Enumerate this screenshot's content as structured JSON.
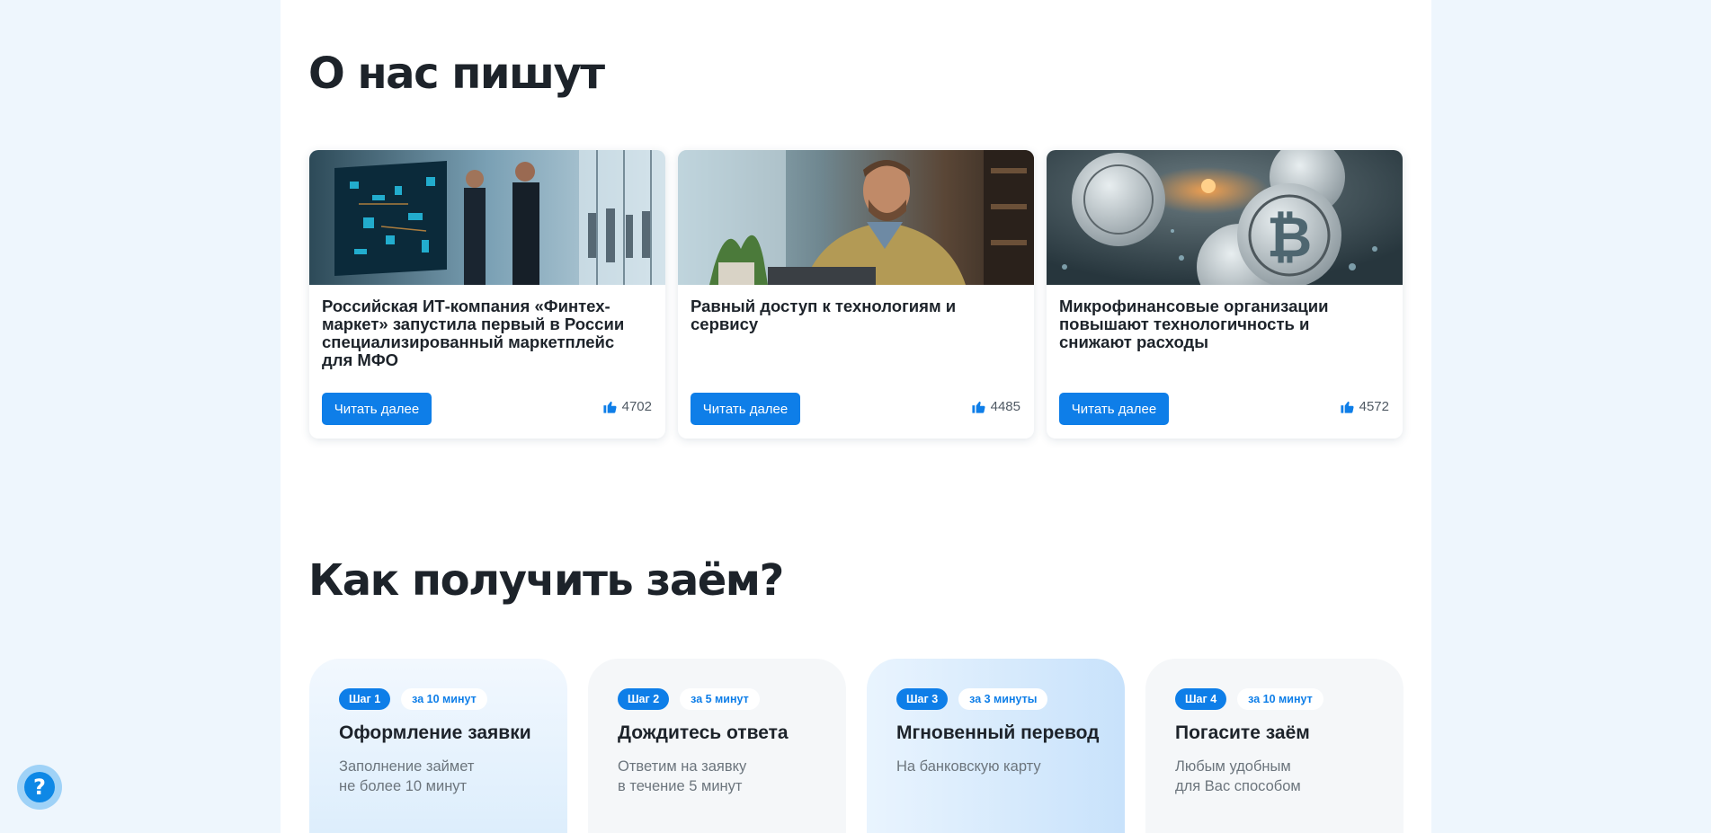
{
  "press": {
    "title": "О нас пишут",
    "read_more_label": "Читать далее",
    "articles": [
      {
        "title": "Российская ИТ-компания «Финтех-маркет» запустила первый в России специализированный маркетплейс для МФО",
        "likes": "4702",
        "image": "business-people-at-digital-screen-photo"
      },
      {
        "title": "Равный доступ к технологиям и сервису",
        "likes": "4485",
        "image": "man-at-laptop-photo"
      },
      {
        "title": "Микрофинансовые организации повышают технологичность и снижают расходы",
        "likes": "4572",
        "image": "bitcoin-coins-photo"
      }
    ]
  },
  "how": {
    "title": "Как получить заём?",
    "steps": [
      {
        "badge": "Шаг 1",
        "time": "за 10 минут",
        "title": "Оформление заявки",
        "text": "Заполнение займет\nне более 10 минут"
      },
      {
        "badge": "Шаг 2",
        "time": "за 5 минут",
        "title": "Дождитесь ответа",
        "text": "Ответим на заявку\nв течение 5 минут"
      },
      {
        "badge": "Шаг 3",
        "time": "за 3 минуты",
        "title": "Мгновенный перевод",
        "text": "На банковскую карту"
      },
      {
        "badge": "Шаг 4",
        "time": "за 10 минут",
        "title": "Погасите заём",
        "text": "Любым удобным\nдля Вас способом"
      }
    ]
  },
  "help_button": {
    "label": "?"
  },
  "colors": {
    "accent": "#0e7ee8",
    "page_bg": "#eef6fd",
    "heading": "#1d232a",
    "muted": "#6c757d"
  }
}
